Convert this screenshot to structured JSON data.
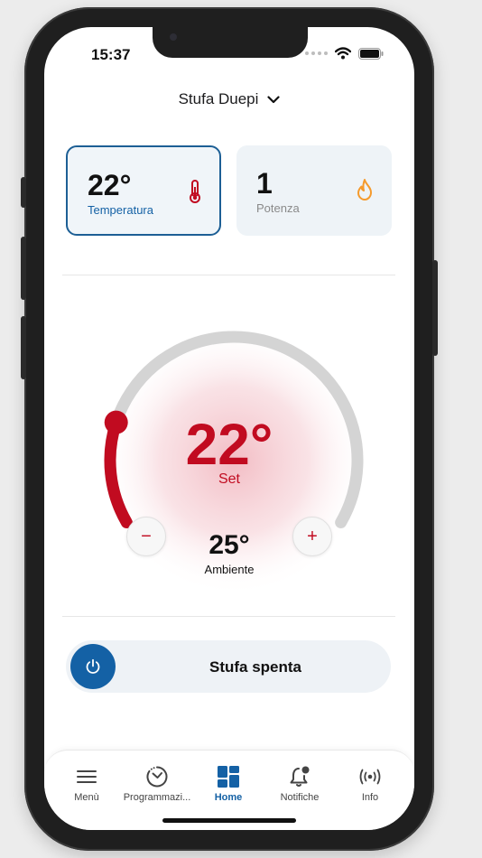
{
  "status": {
    "time": "15:37"
  },
  "header": {
    "device_name": "Stufa Duepi"
  },
  "cards": [
    {
      "value": "22°",
      "label": "Temperatura",
      "icon": "thermometer-icon",
      "active": true
    },
    {
      "value": "1",
      "label": "Potenza",
      "icon": "flame-icon",
      "active": false
    }
  ],
  "dial": {
    "set_value": "22°",
    "set_label": "Set",
    "minus_label": "−",
    "plus_label": "+",
    "ambient_value": "25°",
    "ambient_label": "Ambiente",
    "level_fraction": 0.2
  },
  "toggle": {
    "label": "Stufa spenta",
    "icon": "power-icon"
  },
  "tabs": [
    {
      "label": "Menù",
      "icon": "menu-icon"
    },
    {
      "label": "Programmazi...",
      "icon": "schedule-icon"
    },
    {
      "label": "Home",
      "icon": "home-grid-icon",
      "selected": true
    },
    {
      "label": "Notifiche",
      "icon": "bell-icon"
    },
    {
      "label": "Info",
      "icon": "broadcast-icon"
    }
  ],
  "colors": {
    "accent_blue": "#1461a5",
    "accent_red": "#c10b20",
    "flame_orange": "#f59a2c",
    "card_bg": "#eef3f7"
  }
}
